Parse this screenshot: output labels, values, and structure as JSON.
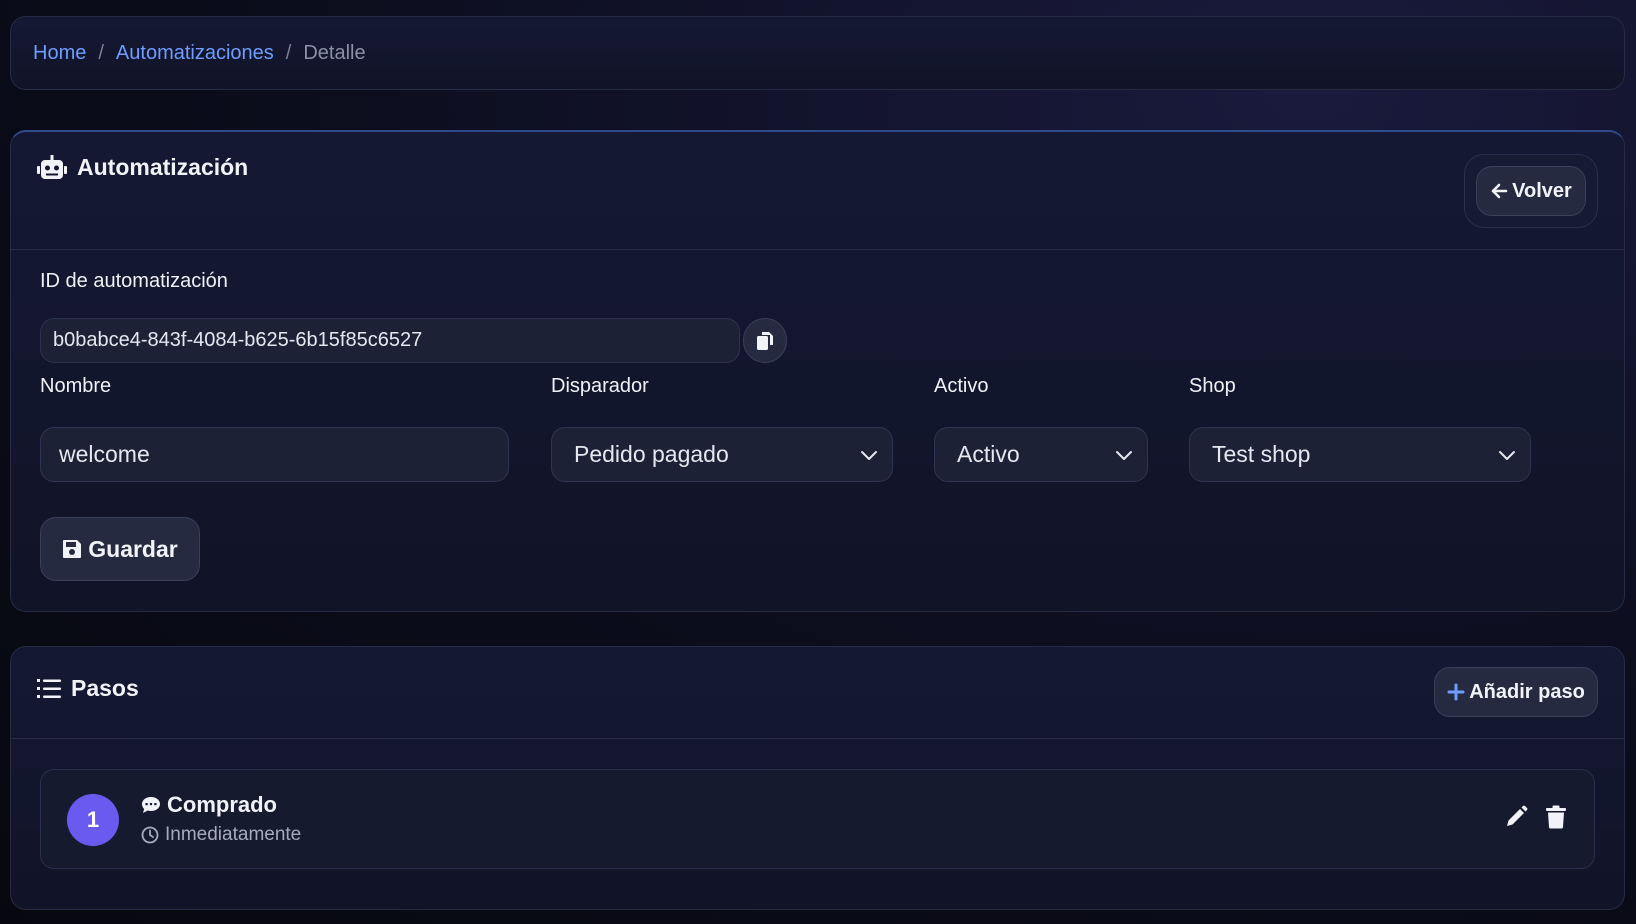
{
  "breadcrumb": {
    "items": [
      {
        "label": "Home"
      },
      {
        "label": "Automatizaciones"
      }
    ],
    "separator": "/",
    "current": "Detalle"
  },
  "automation": {
    "title": "Automatización",
    "back_button": "Volver",
    "id_label": "ID de automatización",
    "id_value": "b0babce4-843f-4084-b625-6b15f85c6527",
    "fields": {
      "nombre": {
        "label": "Nombre",
        "value": "welcome"
      },
      "disparador": {
        "label": "Disparador",
        "value": "Pedido pagado"
      },
      "activo": {
        "label": "Activo",
        "value": "Activo"
      },
      "shop": {
        "label": "Shop",
        "value": "Test shop"
      }
    },
    "save_button": "Guardar"
  },
  "steps": {
    "title": "Pasos",
    "add_button": "Añadir paso",
    "items": [
      {
        "number": "1",
        "title": "Comprado",
        "timing": "Inmediatamente"
      }
    ]
  },
  "colors": {
    "accent": "#6f9dff",
    "step_badge": "#6a5bf0",
    "add_icon": "#6f9dff"
  }
}
